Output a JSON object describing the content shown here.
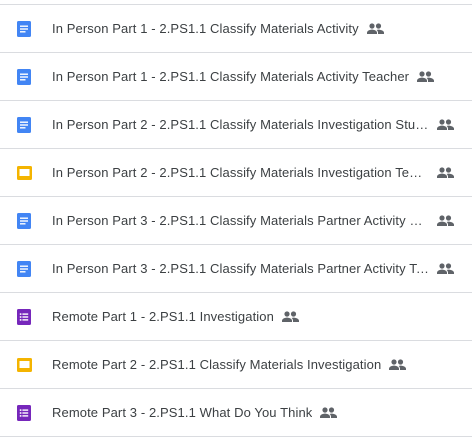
{
  "files": [
    {
      "name": "In Person Part 1 - 2.PS1.1 Classify Materials Activity",
      "type": "docs",
      "shared": true
    },
    {
      "name": "In Person Part 1 - 2.PS1.1 Classify Materials Activity Teacher",
      "type": "docs",
      "shared": true
    },
    {
      "name": "In Person Part 2 - 2.PS1.1 Classify Materials Investigation Stud…",
      "type": "docs",
      "shared": true
    },
    {
      "name": "In Person Part 2 - 2.PS1.1 Classify Materials Investigation Teac…",
      "type": "slides",
      "shared": true
    },
    {
      "name": "In Person Part 3 - 2.PS1.1 Classify Materials Partner Activity St…",
      "type": "docs",
      "shared": true
    },
    {
      "name": "In Person Part 3 - 2.PS1.1 Classify Materials Partner Activity Te…",
      "type": "docs",
      "shared": true
    },
    {
      "name": "Remote Part 1 - 2.PS1.1 Investigation",
      "type": "forms",
      "shared": true
    },
    {
      "name": "Remote Part 2 - 2.PS1.1 Classify Materials Investigation",
      "type": "slides",
      "shared": true
    },
    {
      "name": "Remote Part 3 - 2.PS1.1 What Do You Think",
      "type": "forms",
      "shared": true
    }
  ],
  "icons": {
    "docs": {
      "name": "google-docs-icon",
      "color": "#4285f4"
    },
    "slides": {
      "name": "google-slides-icon",
      "color": "#f4b400"
    },
    "forms": {
      "name": "google-forms-icon",
      "color": "#7627bb"
    },
    "shared": {
      "name": "shared-people-icon",
      "color": "#5f6368"
    }
  }
}
